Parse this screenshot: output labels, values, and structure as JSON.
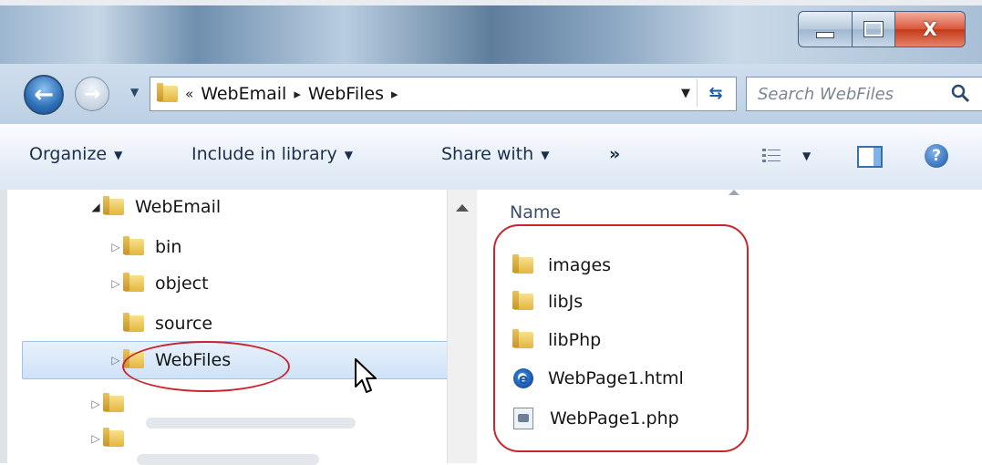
{
  "window": {
    "controls": {
      "minimize": "minimize",
      "maximize": "maximize",
      "close": "X"
    }
  },
  "address": {
    "overflow": "«",
    "breadcrumbs": [
      "WebEmail",
      "WebFiles"
    ],
    "separator": "▸",
    "search_placeholder": "Search WebFiles"
  },
  "toolbar": {
    "organize": "Organize",
    "include_in_library": "Include in library",
    "share_with": "Share with",
    "more": "»"
  },
  "tree": {
    "items": [
      {
        "label": "WebEmail",
        "expanded": true
      },
      {
        "label": "bin"
      },
      {
        "label": "object"
      },
      {
        "label": "source"
      },
      {
        "label": "WebFiles",
        "selected": true
      }
    ]
  },
  "files": {
    "column_name": "Name",
    "items": [
      {
        "label": "images",
        "icon": "folder-icon"
      },
      {
        "label": "libJs",
        "icon": "folder-icon"
      },
      {
        "label": "libPhp",
        "icon": "folder-icon"
      },
      {
        "label": "WebPage1.html",
        "icon": "ie-html-icon"
      },
      {
        "label": "WebPage1.php",
        "icon": "php-file-icon"
      }
    ]
  },
  "colors": {
    "annotation_red": "#c8262c",
    "selection_blue": "#cfe2f7",
    "folder_yellow": "#e3b640"
  }
}
